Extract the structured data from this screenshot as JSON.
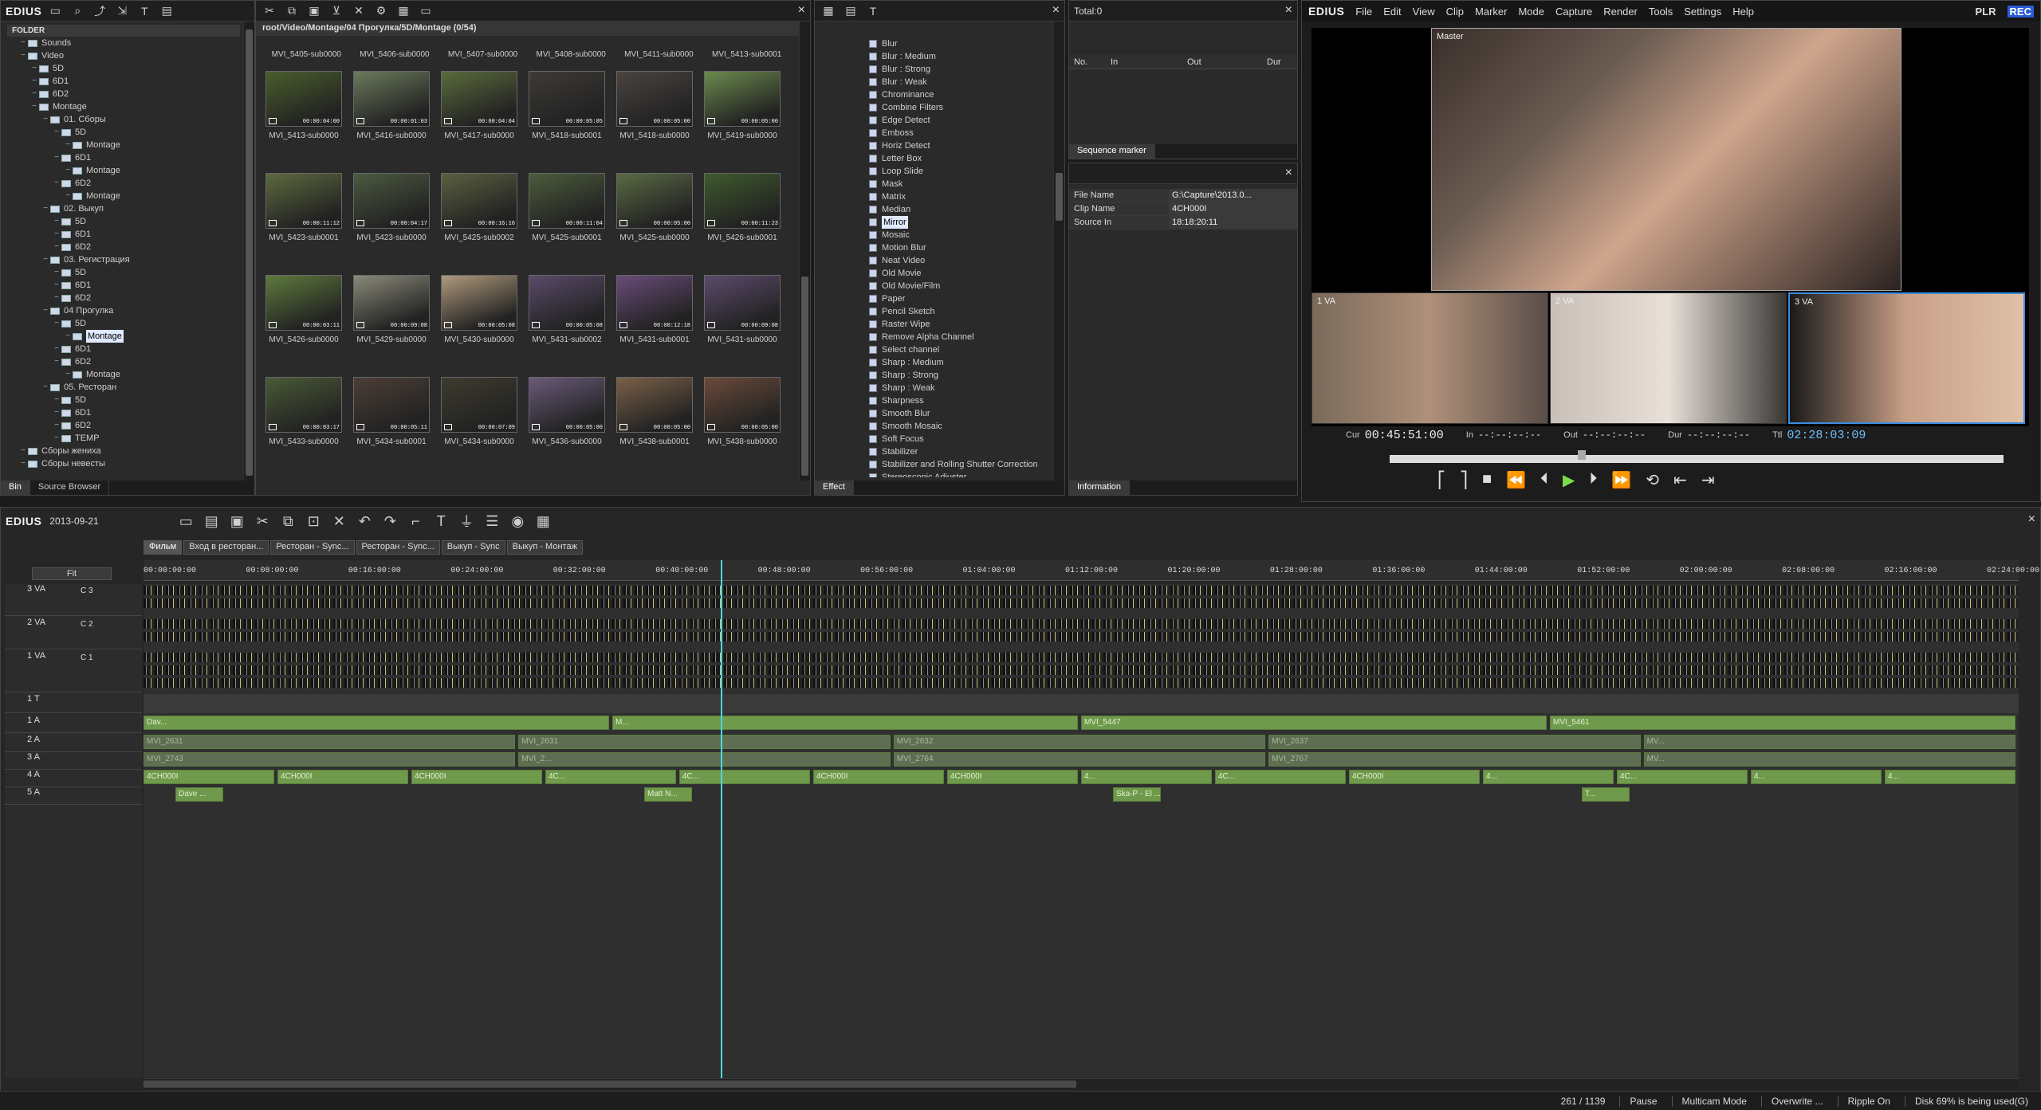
{
  "app": {
    "name": "EDIUS",
    "close": "×"
  },
  "bin_tree": {
    "header": "FOLDER",
    "items": [
      {
        "label": "Sounds",
        "depth": 1
      },
      {
        "label": "Video",
        "depth": 1
      },
      {
        "label": "5D",
        "depth": 2
      },
      {
        "label": "6D1",
        "depth": 2
      },
      {
        "label": "6D2",
        "depth": 2
      },
      {
        "label": "Montage",
        "depth": 2
      },
      {
        "label": "01. Сборы",
        "depth": 3
      },
      {
        "label": "5D",
        "depth": 4
      },
      {
        "label": "Montage",
        "depth": 5
      },
      {
        "label": "6D1",
        "depth": 4
      },
      {
        "label": "Montage",
        "depth": 5
      },
      {
        "label": "6D2",
        "depth": 4
      },
      {
        "label": "Montage",
        "depth": 5
      },
      {
        "label": "02. Выкуп",
        "depth": 3
      },
      {
        "label": "5D",
        "depth": 4
      },
      {
        "label": "6D1",
        "depth": 4
      },
      {
        "label": "6D2",
        "depth": 4
      },
      {
        "label": "03. Регистрация",
        "depth": 3
      },
      {
        "label": "5D",
        "depth": 4
      },
      {
        "label": "6D1",
        "depth": 4
      },
      {
        "label": "6D2",
        "depth": 4
      },
      {
        "label": "04 Прогулка",
        "depth": 3
      },
      {
        "label": "5D",
        "depth": 4
      },
      {
        "label": "Montage",
        "depth": 5,
        "selected": true
      },
      {
        "label": "6D1",
        "depth": 4
      },
      {
        "label": "6D2",
        "depth": 4
      },
      {
        "label": "Montage",
        "depth": 5
      },
      {
        "label": "05. Ресторан",
        "depth": 3
      },
      {
        "label": "5D",
        "depth": 4
      },
      {
        "label": "6D1",
        "depth": 4
      },
      {
        "label": "6D2",
        "depth": 4
      },
      {
        "label": "TEMP",
        "depth": 4
      },
      {
        "label": "Сборы жениха",
        "depth": 1
      },
      {
        "label": "Сборы невесты",
        "depth": 1
      }
    ],
    "tabs": [
      "Bin",
      "Source Browser"
    ]
  },
  "bin": {
    "path": "root/Video/Montage/04 Прогулка/5D/Montage (0/54)",
    "top_row": [
      "MVI_5405-sub0000",
      "MVI_5406-sub0000",
      "MVI_5407-sub0000",
      "MVI_5408-sub0000",
      "MVI_5411-sub0000",
      "MVI_5413-sub0001"
    ],
    "clips": [
      {
        "name": "MVI_5413-sub0000",
        "tc": "00:00:04:00",
        "color": "#4a5e2c"
      },
      {
        "name": "MVI_5416-sub0000",
        "tc": "00:00:01:03",
        "color": "#6b7a5c"
      },
      {
        "name": "MVI_5417-sub0000",
        "tc": "00:00:04:04",
        "color": "#5a6b3c"
      },
      {
        "name": "MVI_5418-sub0001",
        "tc": "00:00:05:05",
        "color": "#3e3a36"
      },
      {
        "name": "MVI_5418-sub0000",
        "tc": "00:00:05:00",
        "color": "#4a4440"
      },
      {
        "name": "MVI_5419-sub0000",
        "tc": "00:00:05:00",
        "color": "#6b8a4c"
      },
      {
        "name": "MVI_5423-sub0001",
        "tc": "00:00:11:12",
        "color": "#5c6a3e"
      },
      {
        "name": "MVI_5423-sub0000",
        "tc": "00:00:04:17",
        "color": "#4c5a40"
      },
      {
        "name": "MVI_5425-sub0002",
        "tc": "00:00:16:16",
        "color": "#5a6040"
      },
      {
        "name": "MVI_5425-sub0001",
        "tc": "00:00:11:04",
        "color": "#4c5c3c"
      },
      {
        "name": "MVI_5425-sub0000",
        "tc": "00:00:05:00",
        "color": "#5a6a44"
      },
      {
        "name": "MVI_5426-sub0001",
        "tc": "00:00:11:23",
        "color": "#3e5a2c"
      },
      {
        "name": "MVI_5426-sub0000",
        "tc": "00:00:03:11",
        "color": "#5e7a3c"
      },
      {
        "name": "MVI_5429-sub0000",
        "tc": "00:00:09:08",
        "color": "#8a8a7a"
      },
      {
        "name": "MVI_5430-sub0000",
        "tc": "00:00:05:08",
        "color": "#b09a7c"
      },
      {
        "name": "MVI_5431-sub0002",
        "tc": "00:00:05:08",
        "color": "#5a4a6a"
      },
      {
        "name": "MVI_5431-sub0001",
        "tc": "00:00:12:18",
        "color": "#6a4c7a"
      },
      {
        "name": "MVI_5431-sub0000",
        "tc": "00:00:09:08",
        "color": "#5c4a6c"
      },
      {
        "name": "MVI_5433-sub0000",
        "tc": "00:00:03:17",
        "color": "#4a5a36"
      },
      {
        "name": "MVI_5434-sub0001",
        "tc": "00:00:05:11",
        "color": "#4c3e36"
      },
      {
        "name": "MVI_5434-sub0000",
        "tc": "00:00:07:09",
        "color": "#3e3a2e"
      },
      {
        "name": "MVI_5436-sub0000",
        "tc": "00:00:05:00",
        "color": "#6a5a7a"
      },
      {
        "name": "MVI_5438-sub0001",
        "tc": "00:00:05:00",
        "color": "#7a6048"
      },
      {
        "name": "MVI_5438-sub0000",
        "tc": "00:00:05:00",
        "color": "#6a4a3a"
      }
    ]
  },
  "effects": {
    "items": [
      "Blur",
      "Blur : Medium",
      "Blur : Strong",
      "Blur : Weak",
      "Chrominance",
      "Combine Filters",
      "Edge Detect",
      "Emboss",
      "Horiz Detect",
      "Letter Box",
      "Loop Slide",
      "Mask",
      "Matrix",
      "Median",
      "Mirror",
      "Mosaic",
      "Motion Blur",
      "Neat Video",
      "Old Movie",
      "Old Movie/Film",
      "Paper",
      "Pencil Sketch",
      "Raster Wipe",
      "Remove Alpha Channel",
      "Select channel",
      "Sharp : Medium",
      "Sharp : Strong",
      "Sharp : Weak",
      "Sharpness",
      "Smooth Blur",
      "Smooth Mosaic",
      "Soft Focus",
      "Stabilizer",
      "Stabilizer and Rolling Shutter Correction",
      "Stereoscopic Adjuster"
    ],
    "selected": "Mirror",
    "tab": "Effect"
  },
  "sequence_marker": {
    "total": "Total:0",
    "columns": [
      "No.",
      "In",
      "Out",
      "Dur"
    ],
    "tab": "Sequence marker"
  },
  "information": {
    "rows": [
      {
        "k": "File Name",
        "v": "G:\\Capture\\2013.0..."
      },
      {
        "k": "Clip Name",
        "v": "4CH000I"
      },
      {
        "k": "Source In",
        "v": "18:18:20:11"
      }
    ],
    "tab": "Information"
  },
  "player": {
    "menu": [
      "File",
      "Edit",
      "View",
      "Clip",
      "Marker",
      "Mode",
      "Capture",
      "Render",
      "Tools",
      "Settings",
      "Help"
    ],
    "right": "PLR",
    "rec": "REC",
    "master_label": "Master",
    "cams": [
      "1 VA",
      "2 VA",
      "3 VA"
    ],
    "tc": {
      "cur_label": "Cur",
      "cur": "00:45:51:00",
      "in_label": "In",
      "in": "--:--:--:--",
      "out_label": "Out",
      "out": "--:--:--:--",
      "dur_label": "Dur",
      "dur": "--:--:--:--",
      "ttl_label": "Ttl",
      "ttl": "02:28:03:09"
    }
  },
  "timeline": {
    "title": "EDIUS",
    "date": "2013-09-21",
    "fit": "Fit",
    "sequences": [
      "Фильм",
      "Вход в ресторан...",
      "Ресторан - Sync...",
      "Ресторан - Sync...",
      "Выкуп - Sync",
      "Выкуп - Монтаж"
    ],
    "ruler": [
      "00:00:00:00",
      "00:08:00:00",
      "00:16:00:00",
      "00:24:00:00",
      "00:32:00:00",
      "00:40:00:00",
      "00:48:00:00",
      "00:56:00:00",
      "01:04:00:00",
      "01:12:00:00",
      "01:20:00:00",
      "01:28:00:00",
      "01:36:00:00",
      "01:44:00:00",
      "01:52:00:00",
      "02:00:00:00",
      "02:08:00:00",
      "02:16:00:00",
      "02:24:00:00"
    ],
    "tracks": [
      {
        "name": "3 VA",
        "patch": "C 3"
      },
      {
        "name": "2 VA",
        "patch": "C 2"
      },
      {
        "name": "1 VA",
        "patch": "C 1"
      },
      {
        "name": "1 T",
        "patch": ""
      },
      {
        "name": "1 A",
        "patch": ""
      },
      {
        "name": "2 A",
        "patch": ""
      },
      {
        "name": "3 A",
        "patch": ""
      },
      {
        "name": "4 A",
        "patch": ""
      },
      {
        "name": "5 A",
        "patch": ""
      }
    ],
    "audio_labels": {
      "a1": [
        "Dav...",
        "M...",
        "MVI_5447",
        "MVI_5461"
      ],
      "a2": [
        "MVI_2631",
        "MVI_2631",
        "MVI_2632",
        "MVI_2637",
        "MV..."
      ],
      "a3": [
        "MVI_2743",
        "MVI_2...",
        "MVI_2764",
        "MVI_2767",
        "MV..."
      ],
      "a4": [
        "4CH000I",
        "4CH000I",
        "4CH000I",
        "4C...",
        "4C...",
        "4CH000I",
        "4CH000I",
        "4...",
        "4C...",
        "4CH000I",
        "4...",
        "4C...",
        "4...",
        "4..."
      ],
      "a5": [
        "Dave ...",
        "Matt N...",
        "Ska-P - El ...",
        "T..."
      ]
    }
  },
  "status": {
    "frames": "261 / 1139",
    "state": "Pause",
    "mode": "Multicam Mode",
    "overwrite": "Overwrite ...",
    "ripple": "Ripple On",
    "disk": "Disk 69% is being used(G)"
  },
  "colors": {
    "accent": "#4fd6e0",
    "audio_clip": "#6f9a4c",
    "clip_yellow": "#c9c27a"
  }
}
